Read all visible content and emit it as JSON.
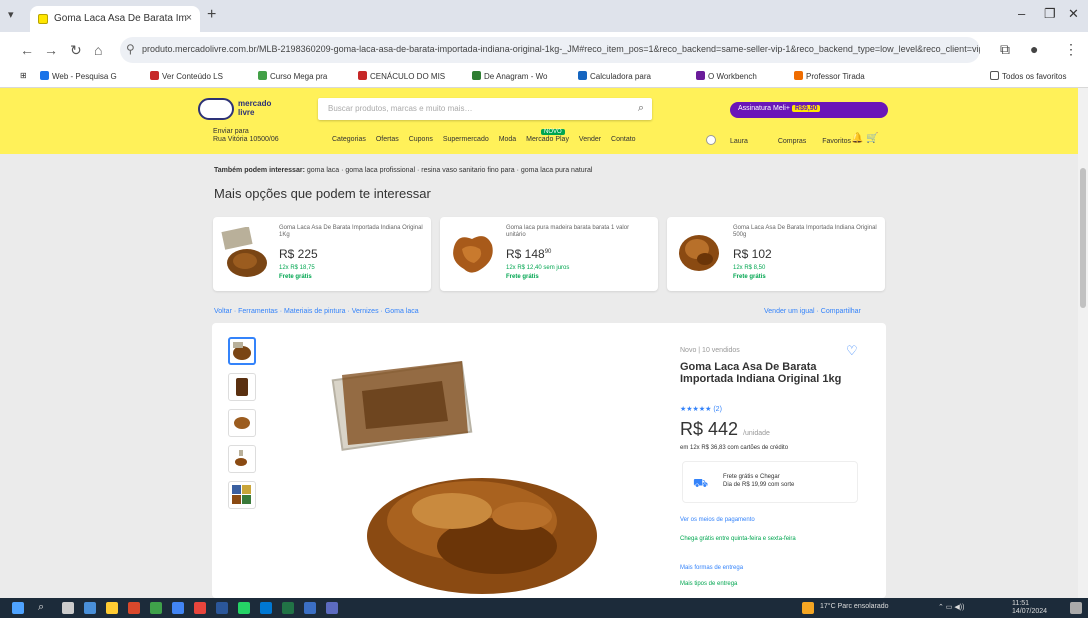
{
  "browser": {
    "tab_title": "Goma Laca Asa De Barata Im",
    "tab_close": "×",
    "new_tab": "+",
    "url": "produto.mercadolivre.com.br/MLB-2198360209-goma-laca-asa-de-barata-importada-indiana-original-1kg-_JM#reco_item_pos=1&reco_backend=same-seller-vip-1&reco_backend_type=low_level&reco_client=vip-seller_items-above",
    "bookmarks": [
      "Web - Pesquisa G",
      "Ver Conteúdo LS",
      "Curso Mega pra",
      "CENÁCULO DO MIS",
      "De Anagram - Wo",
      "Calculadora para",
      "O Workbench",
      "Professor Tirada",
      "Todos os favoritos"
    ]
  },
  "header": {
    "logo_line1": "mercado",
    "logo_line2": "livre",
    "search_placeholder": "Buscar produtos, marcas e muito mais…",
    "promo_text": "Assinatura Meli+",
    "promo_badge": "R$9,90",
    "cep_line1": "Enviar para",
    "cep_line2": "Rua Vitória 10500/06",
    "categories": [
      "Categorias",
      "Ofertas",
      "Cupons",
      "Supermercado",
      "Moda",
      "Mercado Play",
      "Vender",
      "Contato"
    ],
    "new_badge": "NOVO",
    "user": [
      "Laura",
      "Compras",
      "Favoritos"
    ]
  },
  "content": {
    "related_label": "Também podem interessar:",
    "related_terms": "goma laca · goma laca profissional · resina vaso sanitario fino para · goma laca pura natural",
    "section_title": "Mais opções que podem te interessar",
    "cards": [
      {
        "title": "Goma Laca Asa De Barata Importada Indiana Original 1Kg",
        "price": "R$ 225",
        "installments": "12x R$ 18,75",
        "shipping": "Frete grátis"
      },
      {
        "title": "Goma laca pura madeira barata barata 1 valor unitário",
        "price": "R$ 148",
        "cents": "90",
        "installments": "12x R$ 12,40 sem juros",
        "shipping": "Frete grátis"
      },
      {
        "title": "Goma Laca Asa De Barata Importada Indiana Original 500g",
        "price": "R$ 102",
        "installments": "12x R$ 8,50",
        "shipping": "Frete grátis"
      }
    ],
    "breadcrumb": "Voltar · Ferramentas · Materiais de pintura · Vernizes · Goma laca",
    "crumbs_right": "Vender um igual · Compartilhar"
  },
  "product": {
    "condition": "Novo | 10 vendidos",
    "title": "Goma Laca Asa De Barata Importada Indiana Original 1kg",
    "rating_stars": "★★★★★",
    "rating_count": "(2)",
    "price": "R$ 442",
    "price_unit": "/unidade",
    "installments": "em 12x R$ 36,83 com cartões de crédito",
    "shipping_title": "Frete grátis e Chegar",
    "shipping_sub": "Dia de R$ 19,99 com sorte",
    "link1": "Ver os meios de pagamento",
    "green1": "Chega grátis entre quinta-feira e sexta-feira",
    "link2": "Mais formas de entrega",
    "green2": "Mais tipos de entrega"
  },
  "taskbar": {
    "weather": "17°C Parc ensolarado",
    "time": "11:51",
    "date": "14/07/2024"
  },
  "colors": {
    "ml_yellow": "#fff159",
    "ml_blue": "#3483fa",
    "ml_green": "#00a650",
    "promo_purple": "#6a16b8"
  }
}
